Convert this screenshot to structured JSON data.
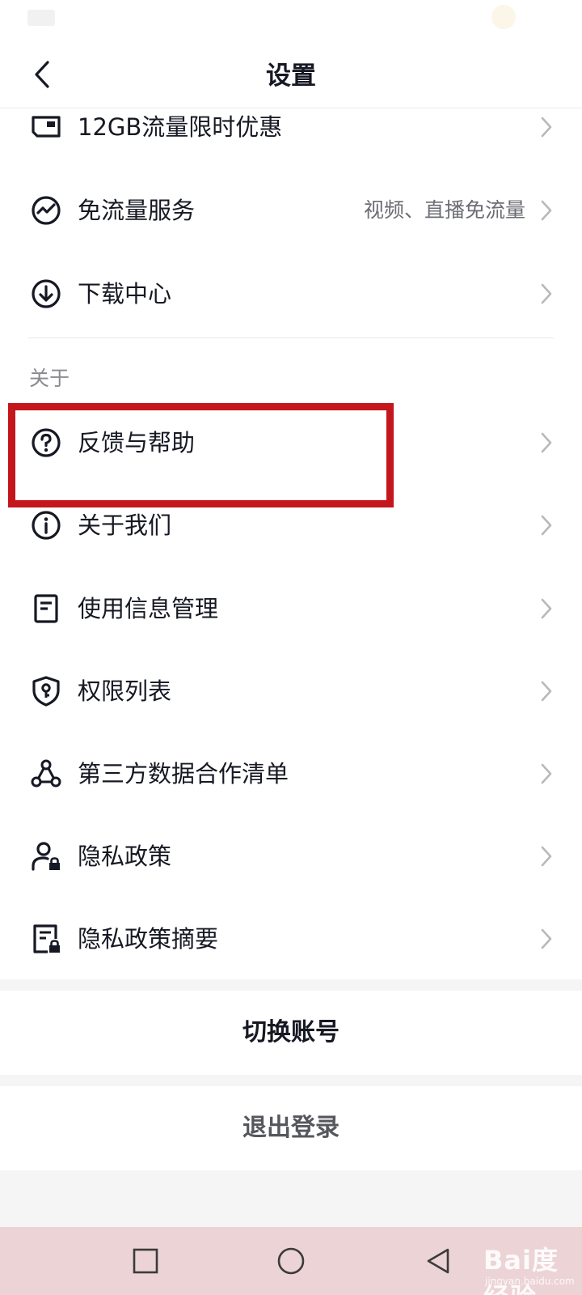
{
  "header": {
    "title": "设置"
  },
  "items": [
    {
      "label": "12GB流量限时优惠",
      "value": "",
      "icon": "sim-card-icon"
    },
    {
      "label": "免流量服务",
      "value": "视频、直播免流量",
      "icon": "wave-circle-icon"
    },
    {
      "label": "下载中心",
      "value": "",
      "icon": "download-icon"
    }
  ],
  "about": {
    "section_title": "关于",
    "items": [
      {
        "label": "反馈与帮助",
        "icon": "help-icon"
      },
      {
        "label": "关于我们",
        "icon": "info-icon"
      },
      {
        "label": "使用信息管理",
        "icon": "document-icon"
      },
      {
        "label": "权限列表",
        "icon": "shield-key-icon"
      },
      {
        "label": "第三方数据合作清单",
        "icon": "network-icon"
      },
      {
        "label": "隐私政策",
        "icon": "user-lock-icon"
      },
      {
        "label": "隐私政策摘要",
        "icon": "document-lock-icon"
      }
    ]
  },
  "actions": {
    "switch_account": "切换账号",
    "logout": "退出登录"
  },
  "watermark": {
    "brand": "Bai度经验",
    "url": "jingyan.baidu.com"
  },
  "colors": {
    "highlight": "#c4161c",
    "nav_bar": "#ecd3d6"
  }
}
